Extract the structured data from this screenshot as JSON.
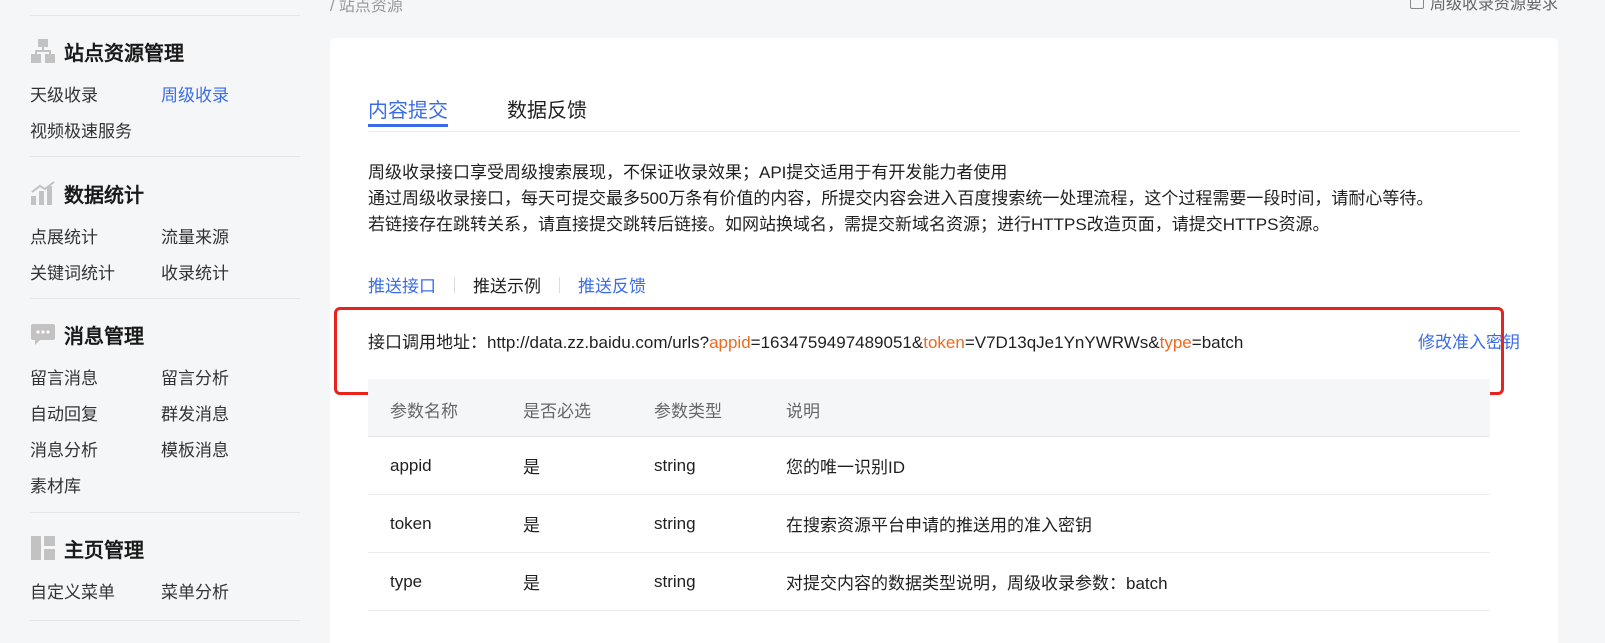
{
  "top": {
    "crumb": "/ 站点资源",
    "right_label": "周级收录资源要求"
  },
  "sidebar": {
    "sections": [
      {
        "title": "站点资源管理",
        "icon": "sitemap-icon",
        "items": [
          "天级收录",
          "周级收录",
          "视频极速服务"
        ]
      },
      {
        "title": "数据统计",
        "icon": "bar-chart-icon",
        "items": [
          "点展统计",
          "流量来源",
          "关键词统计",
          "收录统计"
        ]
      },
      {
        "title": "消息管理",
        "icon": "message-icon",
        "items": [
          "留言消息",
          "留言分析",
          "自动回复",
          "群发消息",
          "消息分析",
          "模板消息",
          "素材库"
        ]
      },
      {
        "title": "主页管理",
        "icon": "layout-icon",
        "items": [
          "自定义菜单",
          "菜单分析"
        ]
      }
    ],
    "active_item": "周级收录"
  },
  "tabs": [
    "内容提交",
    "数据反馈"
  ],
  "description": [
    "周级收录接口享受周级搜索展现，不保证收录效果；API提交适用于有开发能力者使用",
    "通过周级收录接口，每天可提交最多500万条有价值的内容，所提交内容会进入百度搜索统一处理流程，这个过程需要一段时间，请耐心等待。",
    "若链接存在跳转关系，请直接提交跳转后链接。如网站换域名，需提交新域名资源；进行HTTPS改造页面，请提交HTTPS资源。"
  ],
  "subnav": [
    "推送接口",
    "推送示例",
    "推送反馈"
  ],
  "api": {
    "label": "接口调用地址：",
    "base": "http://data.zz.baidu.com/urls?",
    "p1": "appid",
    "v1": "=1634759497489051&",
    "p2": "token",
    "v2": "=V7D13qJe1YnYWRWs&",
    "p3": "type",
    "v3": "=batch",
    "modify": "修改准入密钥"
  },
  "table": {
    "headers": [
      "参数名称",
      "是否必选",
      "参数类型",
      "说明"
    ],
    "rows": [
      [
        "appid",
        "是",
        "string",
        "您的唯一识别ID"
      ],
      [
        "token",
        "是",
        "string",
        "在搜索资源平台申请的推送用的准入密钥"
      ],
      [
        "type",
        "是",
        "string",
        "对提交内容的数据类型说明，周级收录参数：batch"
      ]
    ]
  },
  "colors": {
    "accent": "#3b6ce8",
    "param": "#ef6a1c",
    "highlight": "#e8231d"
  }
}
